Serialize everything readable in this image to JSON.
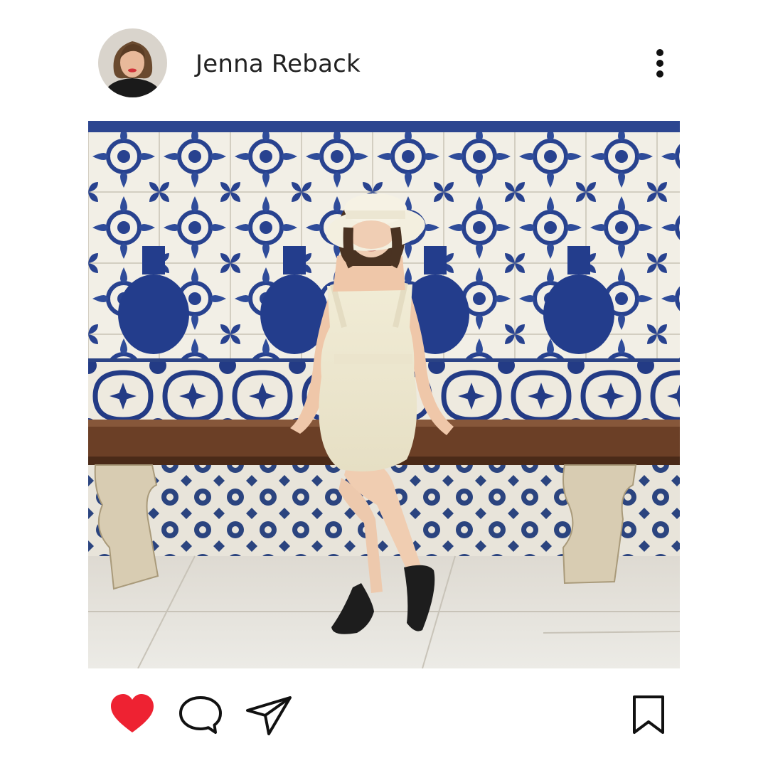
{
  "post": {
    "username": "Jenna Reback",
    "liked": true,
    "colors": {
      "like": "#ee2232",
      "icon_stroke": "#111111",
      "tile_blue": "#28428f",
      "tile_white": "#f2efe6"
    }
  },
  "header": {
    "avatar_icon": "profile-photo",
    "more_icon": "vertical-ellipsis-icon"
  },
  "actions": {
    "like_icon": "heart-icon",
    "comment_icon": "speech-bubble-icon",
    "share_icon": "paper-plane-icon",
    "save_icon": "bookmark-icon"
  }
}
